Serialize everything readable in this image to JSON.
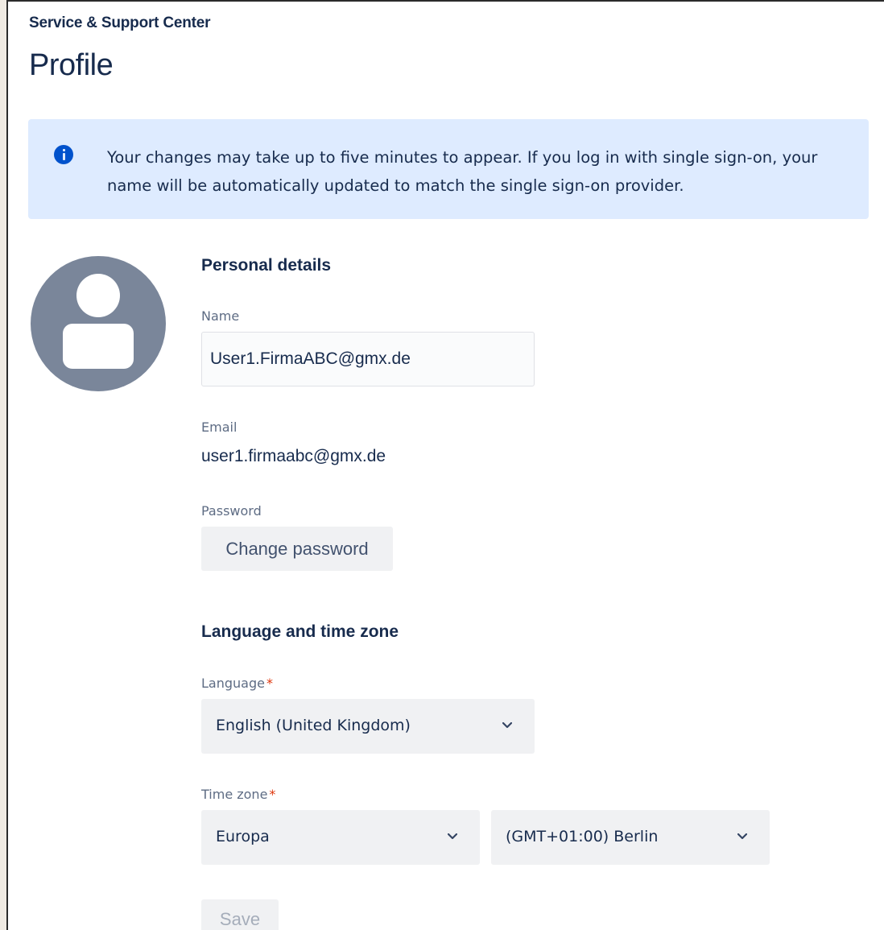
{
  "header": {
    "site_title": "Service & Support Center",
    "page_title": "Profile"
  },
  "info_banner": {
    "icon": "info-icon",
    "text": "Your changes may take up to five minutes to appear. If you log in with single sign-on, your name will be automatically updated to match the single sign-on provider."
  },
  "avatar": {
    "icon": "user-avatar-icon"
  },
  "personal_details": {
    "heading": "Personal details",
    "name_label": "Name",
    "name_value": "User1.FirmaABC@gmx.de",
    "email_label": "Email",
    "email_value": "user1.firmaabc@gmx.de",
    "password_label": "Password",
    "change_password_label": "Change password"
  },
  "language_time_zone": {
    "heading": "Language and time zone",
    "language_label": "Language",
    "language_value": "English (United Kingdom)",
    "time_zone_label": "Time zone",
    "region_value": "Europa",
    "city_value": "(GMT+01:00) Berlin",
    "required_mark": "*"
  },
  "actions": {
    "save_label": "Save"
  },
  "colors": {
    "banner_background": "#deebff",
    "info_icon": "#0052cc",
    "avatar_background": "#7a869a",
    "required_mark": "#de350b",
    "text_primary": "#172b4d"
  }
}
